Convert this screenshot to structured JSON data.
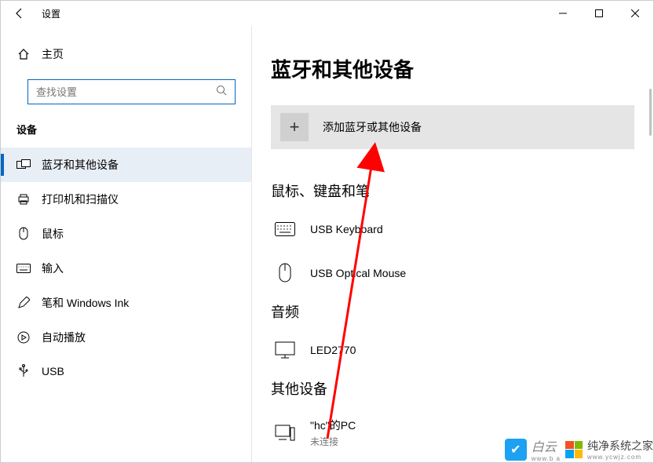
{
  "titlebar": {
    "title": "设置"
  },
  "sidebar": {
    "home": "主页",
    "search_placeholder": "查找设置",
    "section": "设备",
    "items": [
      {
        "label": "蓝牙和其他设备"
      },
      {
        "label": "打印机和扫描仪"
      },
      {
        "label": "鼠标"
      },
      {
        "label": "输入"
      },
      {
        "label": "笔和 Windows Ink"
      },
      {
        "label": "自动播放"
      },
      {
        "label": "USB"
      }
    ]
  },
  "main": {
    "title": "蓝牙和其他设备",
    "add_label": "添加蓝牙或其他设备",
    "cat1": "鼠标、键盘和笔",
    "dev1": "USB Keyboard",
    "dev2": "USB Optical Mouse",
    "cat2": "音频",
    "dev3": "LED2770",
    "cat3": "其他设备",
    "dev4": "\"hc\"的PC",
    "dev4_status": "未连接"
  },
  "watermark": {
    "brand": "白云",
    "site": "纯净系统之家",
    "url": "www.ycwjz.com",
    "url2": "www.b a"
  }
}
